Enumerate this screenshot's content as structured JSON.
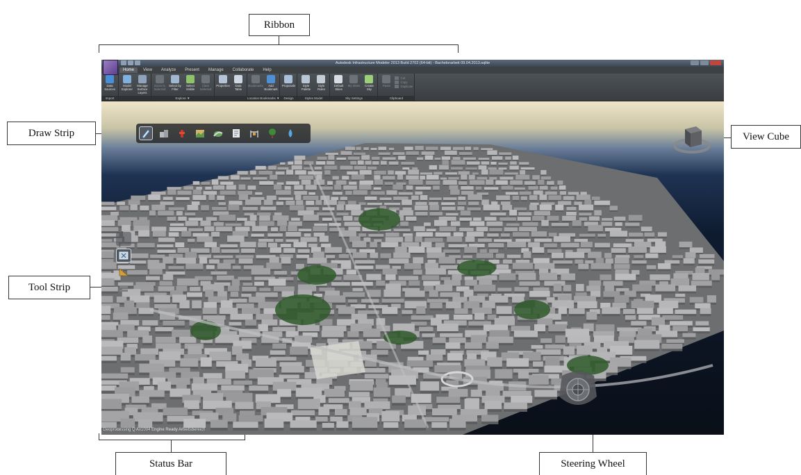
{
  "callouts": {
    "ribbon": "Ribbon",
    "draw_strip": "Draw Strip",
    "view_cube": "View Cube",
    "tool_strip": "Tool Strip",
    "status_bar": "Status Bar",
    "steering_wheel": "Steering Wheel"
  },
  "app": {
    "title": "Autodesk Infrastructure Modeler 2013  Build 2702 (64-bit) - Bachelorarbeit 09.04.2013.sqlite",
    "tabs": [
      "Home",
      "View",
      "Analyze",
      "Present",
      "Manage",
      "Collaborate",
      "Help"
    ],
    "active_tab": "Home",
    "ribbon_groups": [
      {
        "footer": "Import",
        "buttons": [
          {
            "label": "Data Sources",
            "color": "#4a8fd6"
          }
        ]
      },
      {
        "footer": "",
        "buttons": [
          {
            "label": "Model Explorer",
            "color": "#7fb0e0"
          },
          {
            "label": "Manage Surface Layers",
            "color": "#8ea4bc"
          }
        ]
      },
      {
        "footer": "Explore ▼",
        "buttons": [
          {
            "label": "Zoom to Selected",
            "color": "#6c7278",
            "dim": true
          },
          {
            "label": "Select by Filter",
            "color": "#9fb8d0"
          },
          {
            "label": "Select Visible",
            "color": "#8fc36b"
          },
          {
            "label": "Clear Selected",
            "color": "#6c7278",
            "dim": true
          }
        ]
      },
      {
        "footer": "",
        "buttons": [
          {
            "label": "Properties",
            "color": "#b4c4d6"
          },
          {
            "label": "Data Table",
            "color": "#cfd8e2"
          }
        ]
      },
      {
        "footer": "Location Bookmarks ▼",
        "buttons": [
          {
            "label": "Bookmarks",
            "color": "#6c7278",
            "dim": true
          },
          {
            "label": "Add Bookmark",
            "color": "#4f8fd2"
          }
        ]
      },
      {
        "footer": "Design",
        "buttons": [
          {
            "label": "Proposals",
            "color": "#a9c0d8"
          }
        ]
      },
      {
        "footer": "Styles Model",
        "buttons": [
          {
            "label": "Style Palette",
            "color": "#b8c6d4"
          },
          {
            "label": "Style Rules",
            "color": "#c4ccd6"
          }
        ]
      },
      {
        "footer": "Sky Settings",
        "buttons": [
          {
            "label": "Default Skies",
            "color": "#d8dde3"
          },
          {
            "label": "My Skies",
            "color": "#6c7278",
            "dim": true
          },
          {
            "label": "Create Sky",
            "color": "#9ccf7a"
          }
        ]
      },
      {
        "footer": "Clipboard",
        "buttons": [
          {
            "label": "Paste",
            "color": "#6c7278",
            "dim": true
          }
        ],
        "small": [
          "Cut",
          "Copy",
          "Duplicate"
        ]
      }
    ],
    "status_text": "Geoprocessing Q  Ax1004  Engine  Ready  Arbeitsbereich"
  },
  "colors": {
    "sky_top": "#f0e4c8",
    "water": "#0e1b2f",
    "building": "#a6a7a8",
    "vegetation": "#2f5a2a"
  },
  "icons": {
    "draw_strip": [
      "pencil-icon",
      "building-icon",
      "hydrant-icon",
      "terrain-icon",
      "road-icon",
      "document-icon",
      "barrier-icon",
      "tree-icon",
      "water-drop-icon"
    ],
    "tool_strip": [
      "select-icon",
      "measure-icon",
      "layers-icon"
    ]
  }
}
